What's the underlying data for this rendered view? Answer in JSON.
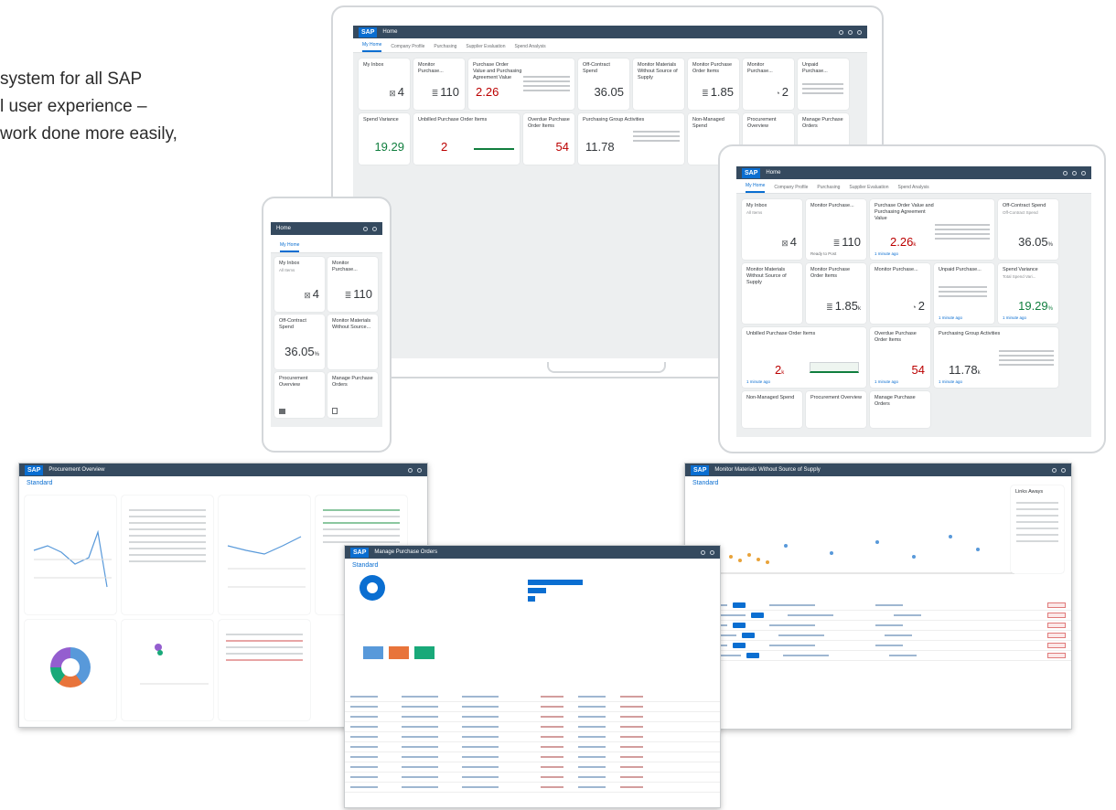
{
  "headline": {
    "line1": "system for all SAP",
    "line2": "l user experience –",
    "line3": "work done more easily,"
  },
  "logo_text": "SAP",
  "laptop": {
    "kpis": [
      "4",
      "110",
      "2.26",
      "36.05",
      "1.85",
      "2",
      "19.29",
      "2",
      "54",
      "11.78"
    ]
  },
  "tablet": {
    "shell_title": "Home",
    "tabs": [
      "My Home",
      "Company Profile",
      "Purchasing",
      "Supplier Evaluation",
      "Spend Analysis"
    ],
    "tiles": {
      "t1": {
        "title": "My Inbox",
        "sub": "All Items",
        "kpi": "4"
      },
      "t2": {
        "title": "Monitor Purchase...",
        "sub": "",
        "kpi": "110",
        "foot": "Ready to Post"
      },
      "t3": {
        "title": "Purchase Order Value and Purchasing Agreement Value",
        "kpi": "2.26",
        "unit": "k",
        "foot": "1 minute ago"
      },
      "t4": {
        "title": "Off-Contract Spend",
        "sub": "Off-Contract Spend",
        "kpi": "36.05",
        "unit": "%"
      },
      "t5": {
        "title": "Monitor Materials Without Source of Supply",
        "sub": ""
      },
      "t6": {
        "title": "Monitor Purchase Order Items",
        "kpi": "1.85",
        "unit": "k"
      },
      "t7": {
        "title": "Monitor Purchase...",
        "kpi": "2"
      },
      "t8": {
        "title": "Unpaid Purchase...",
        "kpi": "",
        "foot": "1 minute ago"
      },
      "t9": {
        "title": "Spend Variance",
        "sub": "Total Spend Vari...",
        "kpi": "19.29",
        "unit": "%",
        "foot": "1 minute ago"
      },
      "t10": {
        "title": "Unbilled Purchase Order Items",
        "kpi": "2",
        "unit": "k",
        "foot": "1 minute ago"
      },
      "t11": {
        "title": "Overdue Purchase Order Items",
        "kpi": "54",
        "foot": "1 minute ago"
      },
      "t12": {
        "title": "Purchasing Group Activities",
        "kpi": "11.78",
        "unit": "k",
        "foot": "1 minute ago"
      },
      "t13": {
        "title": "Non-Managed Spend"
      },
      "t14": {
        "title": "Procurement Overview"
      },
      "t15": {
        "title": "Manage Purchase Orders"
      }
    }
  },
  "phone": {
    "shell_title": "Home",
    "tiles": [
      {
        "title": "My Inbox",
        "sub": "All Items",
        "kpi": "4"
      },
      {
        "title": "Monitor Purchase...",
        "kpi": "110"
      },
      {
        "title": "Off-Contract Spend",
        "kpi": "36.05",
        "unit": "%"
      },
      {
        "title": "Monitor Materials Without Source...",
        "kpi": ""
      },
      {
        "title": "Procurement Overview",
        "kpi": ""
      },
      {
        "title": "Manage Purchase Orders",
        "kpi": ""
      }
    ]
  },
  "window_a": {
    "title": "Procurement Overview",
    "header": "Standard"
  },
  "window_b": {
    "title": "Monitor Materials Without Source of Supply",
    "header": "Standard",
    "side_title": "Links Aways"
  },
  "window_c": {
    "title": "Manage Purchase Orders",
    "header": "Standard"
  }
}
